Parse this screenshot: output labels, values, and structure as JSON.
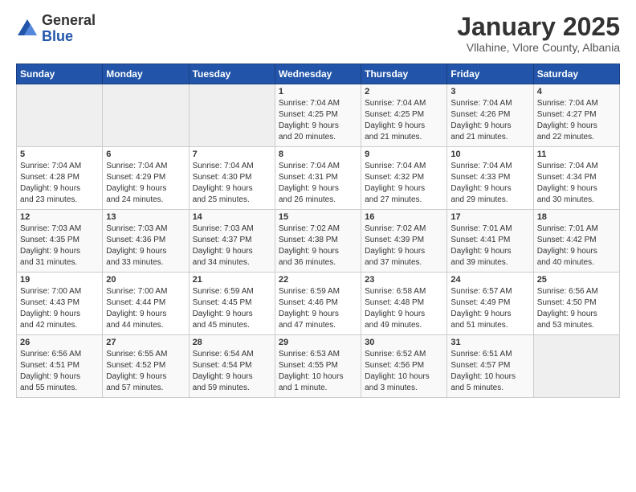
{
  "header": {
    "logo_general": "General",
    "logo_blue": "Blue",
    "title": "January 2025",
    "subtitle": "Vllahine, Vlore County, Albania"
  },
  "days_of_week": [
    "Sunday",
    "Monday",
    "Tuesday",
    "Wednesday",
    "Thursday",
    "Friday",
    "Saturday"
  ],
  "weeks": [
    [
      {
        "day": "",
        "content": ""
      },
      {
        "day": "",
        "content": ""
      },
      {
        "day": "",
        "content": ""
      },
      {
        "day": "1",
        "content": "Sunrise: 7:04 AM\nSunset: 4:25 PM\nDaylight: 9 hours\nand 20 minutes."
      },
      {
        "day": "2",
        "content": "Sunrise: 7:04 AM\nSunset: 4:25 PM\nDaylight: 9 hours\nand 21 minutes."
      },
      {
        "day": "3",
        "content": "Sunrise: 7:04 AM\nSunset: 4:26 PM\nDaylight: 9 hours\nand 21 minutes."
      },
      {
        "day": "4",
        "content": "Sunrise: 7:04 AM\nSunset: 4:27 PM\nDaylight: 9 hours\nand 22 minutes."
      }
    ],
    [
      {
        "day": "5",
        "content": "Sunrise: 7:04 AM\nSunset: 4:28 PM\nDaylight: 9 hours\nand 23 minutes."
      },
      {
        "day": "6",
        "content": "Sunrise: 7:04 AM\nSunset: 4:29 PM\nDaylight: 9 hours\nand 24 minutes."
      },
      {
        "day": "7",
        "content": "Sunrise: 7:04 AM\nSunset: 4:30 PM\nDaylight: 9 hours\nand 25 minutes."
      },
      {
        "day": "8",
        "content": "Sunrise: 7:04 AM\nSunset: 4:31 PM\nDaylight: 9 hours\nand 26 minutes."
      },
      {
        "day": "9",
        "content": "Sunrise: 7:04 AM\nSunset: 4:32 PM\nDaylight: 9 hours\nand 27 minutes."
      },
      {
        "day": "10",
        "content": "Sunrise: 7:04 AM\nSunset: 4:33 PM\nDaylight: 9 hours\nand 29 minutes."
      },
      {
        "day": "11",
        "content": "Sunrise: 7:04 AM\nSunset: 4:34 PM\nDaylight: 9 hours\nand 30 minutes."
      }
    ],
    [
      {
        "day": "12",
        "content": "Sunrise: 7:03 AM\nSunset: 4:35 PM\nDaylight: 9 hours\nand 31 minutes."
      },
      {
        "day": "13",
        "content": "Sunrise: 7:03 AM\nSunset: 4:36 PM\nDaylight: 9 hours\nand 33 minutes."
      },
      {
        "day": "14",
        "content": "Sunrise: 7:03 AM\nSunset: 4:37 PM\nDaylight: 9 hours\nand 34 minutes."
      },
      {
        "day": "15",
        "content": "Sunrise: 7:02 AM\nSunset: 4:38 PM\nDaylight: 9 hours\nand 36 minutes."
      },
      {
        "day": "16",
        "content": "Sunrise: 7:02 AM\nSunset: 4:39 PM\nDaylight: 9 hours\nand 37 minutes."
      },
      {
        "day": "17",
        "content": "Sunrise: 7:01 AM\nSunset: 4:41 PM\nDaylight: 9 hours\nand 39 minutes."
      },
      {
        "day": "18",
        "content": "Sunrise: 7:01 AM\nSunset: 4:42 PM\nDaylight: 9 hours\nand 40 minutes."
      }
    ],
    [
      {
        "day": "19",
        "content": "Sunrise: 7:00 AM\nSunset: 4:43 PM\nDaylight: 9 hours\nand 42 minutes."
      },
      {
        "day": "20",
        "content": "Sunrise: 7:00 AM\nSunset: 4:44 PM\nDaylight: 9 hours\nand 44 minutes."
      },
      {
        "day": "21",
        "content": "Sunrise: 6:59 AM\nSunset: 4:45 PM\nDaylight: 9 hours\nand 45 minutes."
      },
      {
        "day": "22",
        "content": "Sunrise: 6:59 AM\nSunset: 4:46 PM\nDaylight: 9 hours\nand 47 minutes."
      },
      {
        "day": "23",
        "content": "Sunrise: 6:58 AM\nSunset: 4:48 PM\nDaylight: 9 hours\nand 49 minutes."
      },
      {
        "day": "24",
        "content": "Sunrise: 6:57 AM\nSunset: 4:49 PM\nDaylight: 9 hours\nand 51 minutes."
      },
      {
        "day": "25",
        "content": "Sunrise: 6:56 AM\nSunset: 4:50 PM\nDaylight: 9 hours\nand 53 minutes."
      }
    ],
    [
      {
        "day": "26",
        "content": "Sunrise: 6:56 AM\nSunset: 4:51 PM\nDaylight: 9 hours\nand 55 minutes."
      },
      {
        "day": "27",
        "content": "Sunrise: 6:55 AM\nSunset: 4:52 PM\nDaylight: 9 hours\nand 57 minutes."
      },
      {
        "day": "28",
        "content": "Sunrise: 6:54 AM\nSunset: 4:54 PM\nDaylight: 9 hours\nand 59 minutes."
      },
      {
        "day": "29",
        "content": "Sunrise: 6:53 AM\nSunset: 4:55 PM\nDaylight: 10 hours\nand 1 minute."
      },
      {
        "day": "30",
        "content": "Sunrise: 6:52 AM\nSunset: 4:56 PM\nDaylight: 10 hours\nand 3 minutes."
      },
      {
        "day": "31",
        "content": "Sunrise: 6:51 AM\nSunset: 4:57 PM\nDaylight: 10 hours\nand 5 minutes."
      },
      {
        "day": "",
        "content": ""
      }
    ]
  ]
}
